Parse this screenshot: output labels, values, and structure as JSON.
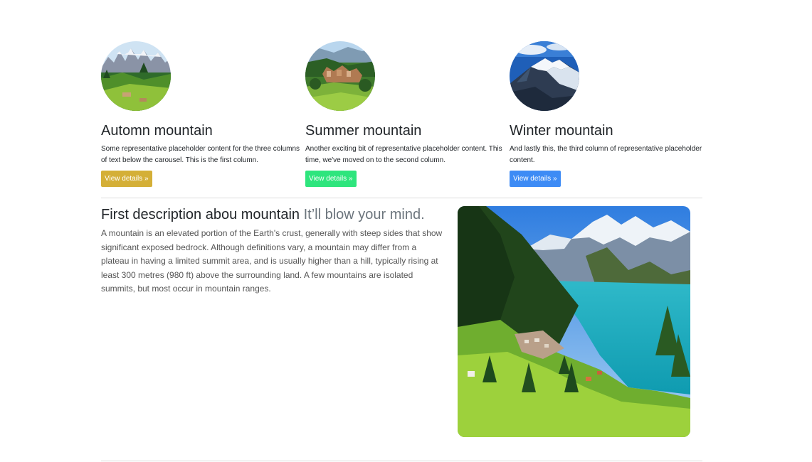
{
  "columns": [
    {
      "image_icon": "mountain-photo-autumn",
      "title": "Automn mountain",
      "text": "Some representative placeholder content for the three columns of text below the carousel. This is the first column.",
      "button_label": "View details »",
      "button_color": "#d4af37"
    },
    {
      "image_icon": "mountain-village-photo-summer",
      "title": "Summer mountain",
      "text": "Another exciting bit of representative placeholder content. This time, we've moved on to the second column.",
      "button_label": "View details »",
      "button_color": "#2ee57d"
    },
    {
      "image_icon": "snowy-peak-photo-winter",
      "title": "Winter mountain",
      "text": "And lastly this, the third column of representative placeholder content.",
      "button_label": "View details »",
      "button_color": "#3d8bf5"
    }
  ],
  "feature": {
    "heading": "First description abou mountain",
    "heading_muted": "It’ll blow your mind.",
    "body": "A mountain is an elevated portion of the Earth's crust, generally with steep sides that show significant exposed bedrock. Although definitions vary, a mountain may differ from a plateau in having a limited summit area, and is usually higher than a hill, typically rising at least 300 metres (980 ft) above the surrounding land. A few mountains are isolated summits, but most occur in mountain ranges.",
    "image_icon": "mountain-lake-photo"
  }
}
